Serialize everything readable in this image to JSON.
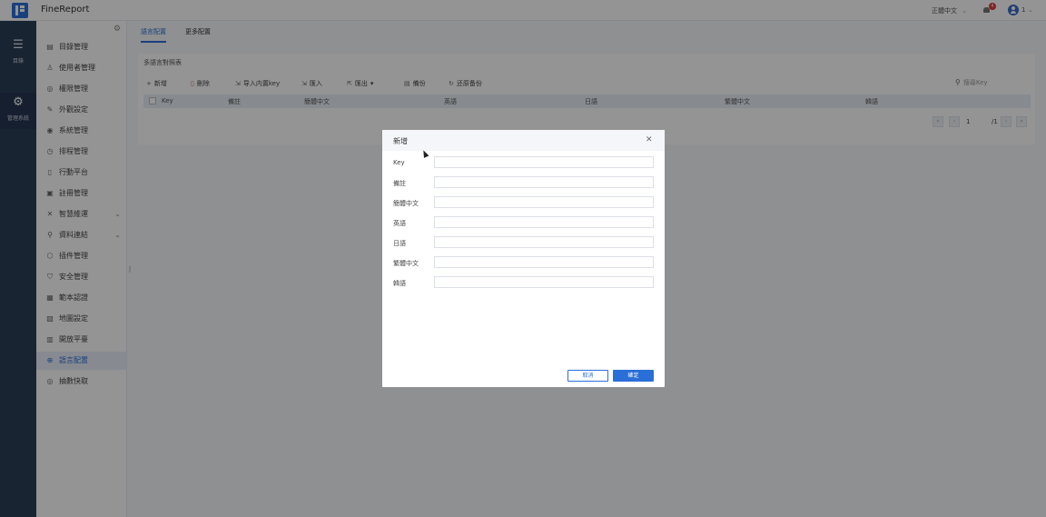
{
  "header": {
    "app_name": "FineReport",
    "language": "正體中文",
    "notification_count": "4",
    "user": "1"
  },
  "rail": [
    {
      "label": "目錄",
      "icon": "list-icon"
    },
    {
      "label": "管理系統",
      "icon": "gear-icon"
    }
  ],
  "menu": [
    {
      "label": "目錄管理",
      "icon": "folder-icon"
    },
    {
      "label": "使用者管理",
      "icon": "user-icon"
    },
    {
      "label": "權限管理",
      "icon": "permission-icon"
    },
    {
      "label": "外觀設定",
      "icon": "appearance-icon"
    },
    {
      "label": "系統管理",
      "icon": "system-icon"
    },
    {
      "label": "排程管理",
      "icon": "schedule-icon"
    },
    {
      "label": "行動平台",
      "icon": "mobile-icon"
    },
    {
      "label": "註冊管理",
      "icon": "register-icon"
    },
    {
      "label": "智慧維運",
      "icon": "ops-icon",
      "expandable": true
    },
    {
      "label": "資料連結",
      "icon": "datalink-icon",
      "expandable": true
    },
    {
      "label": "插件管理",
      "icon": "plugin-icon"
    },
    {
      "label": "安全管理",
      "icon": "security-icon"
    },
    {
      "label": "範本認證",
      "icon": "template-icon"
    },
    {
      "label": "地圖設定",
      "icon": "map-icon"
    },
    {
      "label": "開放平臺",
      "icon": "open-platform-icon"
    },
    {
      "label": "語言配置",
      "icon": "globe-icon",
      "active": true
    },
    {
      "label": "抽數快取",
      "icon": "cache-icon"
    }
  ],
  "tabs": [
    {
      "label": "語言配置",
      "active": true
    },
    {
      "label": "更多配置",
      "active": false
    }
  ],
  "panel": {
    "title": "多語言對照表",
    "toolbar": {
      "add": "新增",
      "delete": "刪除",
      "import_builtin": "导入内置key",
      "import": "匯入",
      "export": "匯出",
      "backup": "備份",
      "restore": "还原备份"
    },
    "search_placeholder": "搜尋Key",
    "columns": [
      "Key",
      "備註",
      "簡體中文",
      "英語",
      "日語",
      "繁體中文",
      "韓語"
    ],
    "pager": {
      "page": "1",
      "total": "/1"
    }
  },
  "modal": {
    "title": "新增",
    "fields": [
      {
        "label": "Key",
        "value": ""
      },
      {
        "label": "備註",
        "value": ""
      },
      {
        "label": "簡體中文",
        "value": ""
      },
      {
        "label": "英語",
        "value": ""
      },
      {
        "label": "日語",
        "value": ""
      },
      {
        "label": "繁體中文",
        "value": ""
      },
      {
        "label": "韓語",
        "value": ""
      }
    ],
    "cancel": "取消",
    "ok": "確定"
  },
  "colors": {
    "accent": "#2a6fd8",
    "rail": "#2c3e56",
    "danger": "#e03a3a"
  }
}
